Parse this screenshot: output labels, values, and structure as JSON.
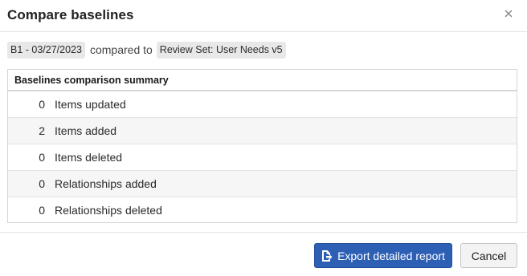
{
  "dialog": {
    "title": "Compare baselines",
    "close_icon": "close-icon"
  },
  "comparison": {
    "baseline": "B1 - 03/27/2023",
    "connector": "compared to",
    "target": "Review Set: User Needs v5"
  },
  "summary": {
    "header": "Baselines comparison summary",
    "rows": [
      {
        "count": "0",
        "label": "Items updated"
      },
      {
        "count": "2",
        "label": "Items added"
      },
      {
        "count": "0",
        "label": "Items deleted"
      },
      {
        "count": "0",
        "label": "Relationships added"
      },
      {
        "count": "0",
        "label": "Relationships deleted"
      }
    ]
  },
  "footer": {
    "export_label": "Export detailed report",
    "export_icon": "export-file-icon",
    "cancel_label": "Cancel"
  },
  "colors": {
    "primary": "#2d5fb5",
    "row_alt": "#f6f6f6",
    "chip_bg": "#e8e8e8"
  }
}
